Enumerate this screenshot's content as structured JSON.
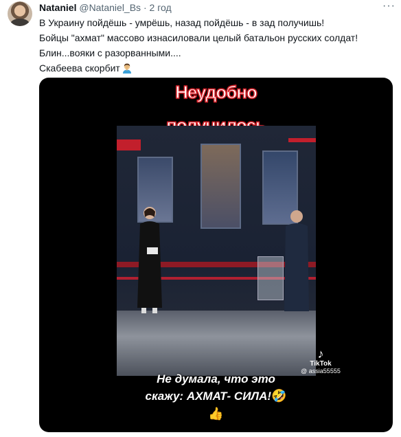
{
  "tweet": {
    "author_name": "Nataniel",
    "author_handle": "@Nataniel_Bs",
    "separator": "·",
    "time": "2 год",
    "more_label": "···",
    "text_lines": [
      "В Украину пойдёшь - умрёшь, назад пойдёшь - в зад получишь!",
      "Бойцы \"ахмат\" массово изнасиловали целый батальон русских солдат!",
      "Блин...вояки с разорванными....",
      " Скабеева скорбит"
    ],
    "emoji": "facepalm-person-emoji"
  },
  "media": {
    "caption_top_line1": "Неудобно",
    "caption_top_line2": "получилось",
    "caption_bottom_line1": "Не думала, что это",
    "caption_bottom_line2": "скажу: АХМАТ- СИЛА!",
    "caption_bottom_emoji": "🤣",
    "caption_bottom_line3": "👍",
    "tiktok_logo": "♪",
    "tiktok_brand": "TikTok",
    "tiktok_user": "@ assia55555",
    "colors": {
      "caption_outline": "#d9222a",
      "background": "#000000"
    }
  }
}
